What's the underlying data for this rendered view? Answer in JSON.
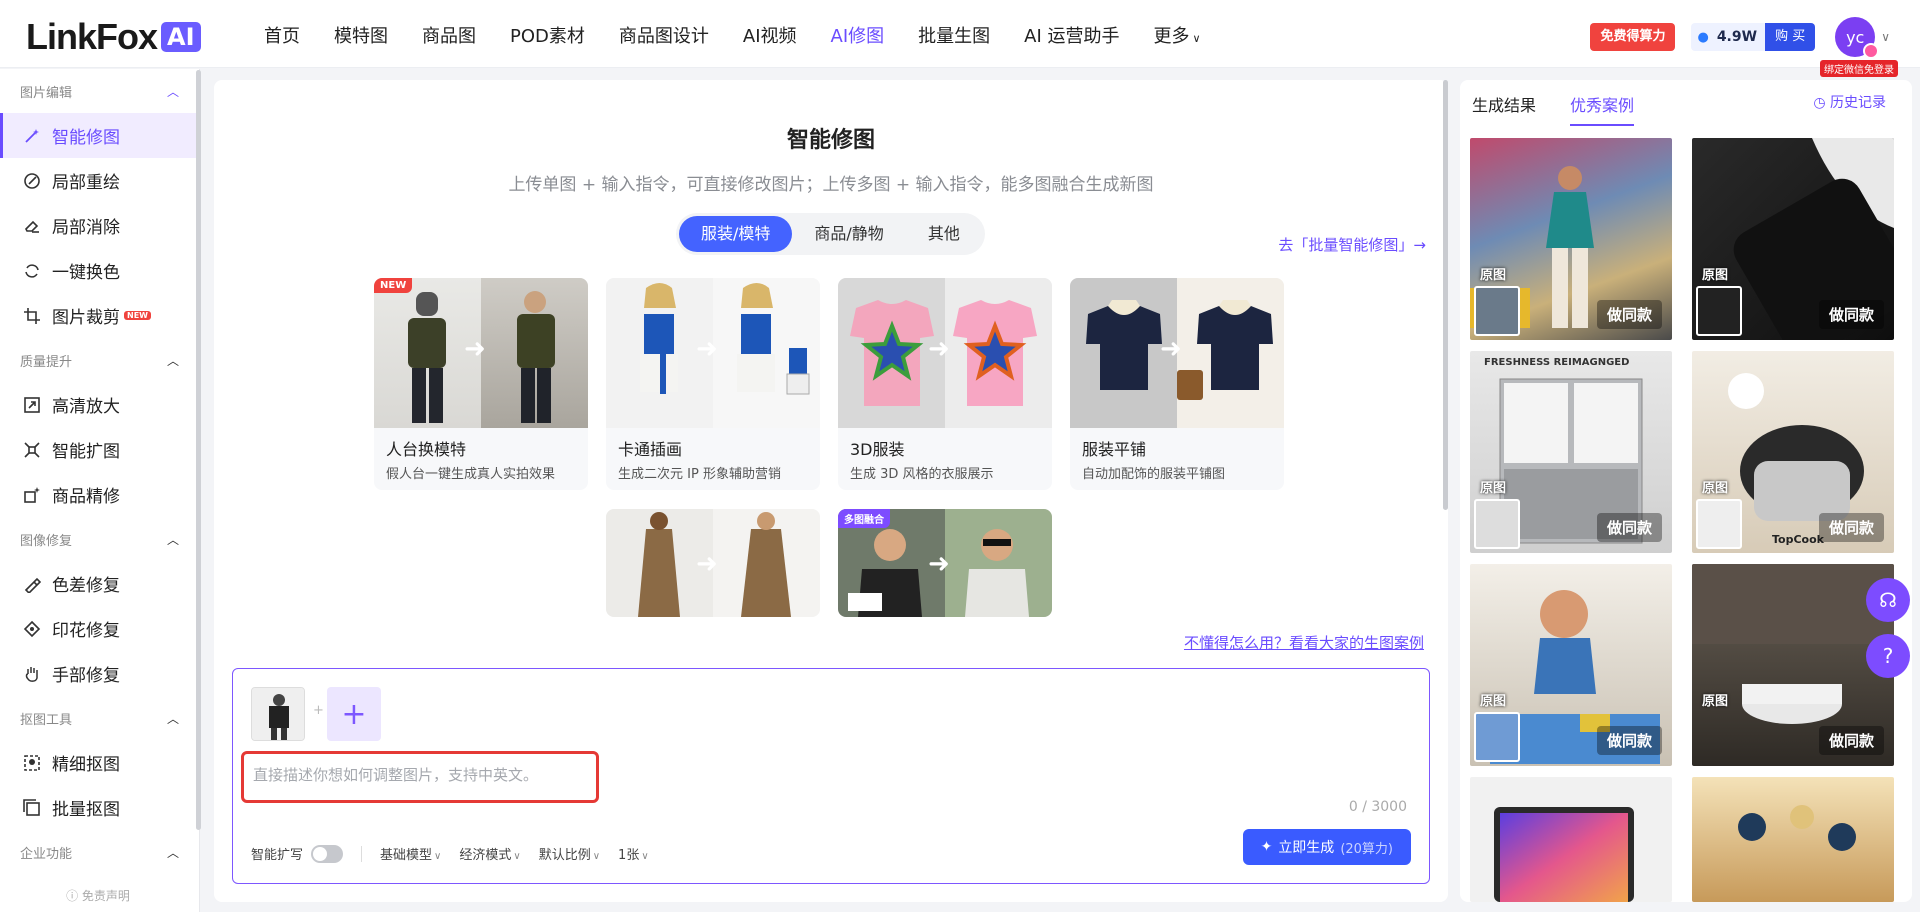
{
  "header": {
    "logo_text": "LinkFox",
    "logo_badge": "AI",
    "nav": [
      "首页",
      "模特图",
      "商品图",
      "POD素材",
      "商品图设计",
      "AI视频",
      "AI修图",
      "批量生图",
      "AI 运营助手",
      "更多"
    ],
    "active_nav": "AI修图",
    "free_btn": "免费得算力",
    "points": "4.9W",
    "buy": "购 买",
    "avatar": "yc",
    "bind_tip": "绑定微信免登录"
  },
  "sidebar": {
    "sections": [
      {
        "title": "图片编辑",
        "items": [
          {
            "label": "智能修图",
            "icon": "magic-wand-icon",
            "active": true
          },
          {
            "label": "局部重绘",
            "icon": "brush-icon"
          },
          {
            "label": "局部消除",
            "icon": "eraser-icon"
          },
          {
            "label": "一键换色",
            "icon": "color-swap-icon"
          },
          {
            "label": "图片裁剪",
            "icon": "crop-icon",
            "tag": "NEW"
          }
        ]
      },
      {
        "title": "质量提升",
        "items": [
          {
            "label": "高清放大",
            "icon": "upscale-icon"
          },
          {
            "label": "智能扩图",
            "icon": "expand-icon"
          },
          {
            "label": "商品精修",
            "icon": "retouch-icon"
          }
        ]
      },
      {
        "title": "图像修复",
        "items": [
          {
            "label": "色差修复",
            "icon": "color-fix-icon"
          },
          {
            "label": "印花修复",
            "icon": "print-fix-icon"
          },
          {
            "label": "手部修复",
            "icon": "hand-icon"
          }
        ]
      },
      {
        "title": "抠图工具",
        "items": [
          {
            "label": "精细抠图",
            "icon": "cutout-icon"
          },
          {
            "label": "批量抠图",
            "icon": "batch-cutout-icon"
          }
        ]
      },
      {
        "title": "企业功能",
        "items": []
      }
    ],
    "disclaimer": "免责声明"
  },
  "main": {
    "title": "智能修图",
    "subtitle": "上传单图 + 输入指令，可直接修改图片；上传多图 + 输入指令，能多图融合生成新图",
    "tabs": [
      "服装/模特",
      "商品/静物",
      "其他"
    ],
    "active_tab": "服装/模特",
    "batch_link": "去「批量智能修图」→",
    "cards": [
      {
        "title": "人台换模特",
        "desc": "假人台一键生成真人实拍效果",
        "tag": "NEW"
      },
      {
        "title": "卡通插画",
        "desc": "生成二次元 IP 形象辅助营销",
        "tag": ""
      },
      {
        "title": "3D服装",
        "desc": "生成 3D 风格的衣服展示",
        "tag": ""
      },
      {
        "title": "服装平铺",
        "desc": "自动加配饰的服装平铺图",
        "tag": ""
      },
      {
        "title": "",
        "desc": "",
        "tag": ""
      },
      {
        "title": "",
        "desc": "",
        "tag": "多图融合"
      }
    ],
    "help_link": "不懂得怎么用？看看大家的生图案例",
    "prompt_placeholder": "直接描述你想如何调整图片，支持中英文。",
    "counter": "0 / 3000",
    "options": {
      "smart_expand": "智能扩写",
      "model": "基础模型",
      "mode": "经济模式",
      "ratio": "默认比例",
      "count": "1张"
    },
    "generate": "立即生成",
    "generate_cost": "(20算力)"
  },
  "right_panel": {
    "tabs": [
      "生成结果",
      "优秀案例"
    ],
    "active_tab": "优秀案例",
    "history": "历史记录",
    "cases": [
      {
        "orig": "原图",
        "same": "做同款"
      },
      {
        "orig": "原图",
        "same": "做同款"
      },
      {
        "orig": "原图",
        "same": "做同款",
        "caption": "FRESHNESS REIMAGNGED"
      },
      {
        "orig": "原图",
        "same": "做同款",
        "caption": "TopCook"
      },
      {
        "orig": "原图",
        "same": "做同款"
      },
      {
        "orig": "原图",
        "same": "做同款"
      }
    ]
  },
  "colors": {
    "accent": "#6a4cff",
    "primary_blue": "#3a5bff",
    "danger": "#f0433e"
  }
}
